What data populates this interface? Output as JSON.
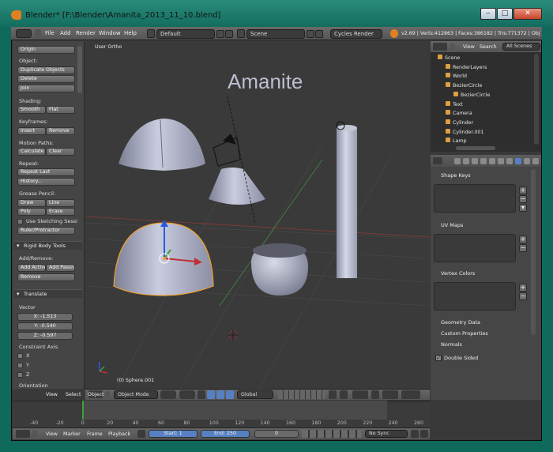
{
  "window": {
    "title": "Blender* [F:\\Blender\\Amanita_2013_11_10.blend]",
    "minimize": "‒",
    "maximize": "□",
    "close": "✕"
  },
  "info": {
    "menus": [
      "File",
      "Add",
      "Render",
      "Window",
      "Help"
    ],
    "layout": "Default",
    "scene": "Scene",
    "engine": "Cycles Render",
    "stats": "v2.69 | Verts:412863 | Faces:386182 | Tris:771372 | Obje"
  },
  "toolshelf": {
    "origin_btn": "Origin",
    "object_label": "Object:",
    "duplicate_btn": "Duplicate Objects",
    "delete_btn": "Delete",
    "join_btn": "Join",
    "shading_label": "Shading:",
    "smooth_btn": "Smooth",
    "flat_btn": "Flat",
    "keyframes_label": "Keyframes:",
    "insert_btn": "Insert",
    "remove_btn": "Remove",
    "motion_label": "Motion Paths:",
    "calculate_btn": "Calculate",
    "clear_btn": "Clear",
    "repeat_label": "Repeat:",
    "repeat_last_btn": "Repeat Last",
    "history_btn": "History...",
    "grease_label": "Grease Pencil:",
    "draw_btn": "Draw",
    "line_btn": "Line",
    "poly_btn": "Poly",
    "erase_btn": "Erase",
    "sketch_label": "Use Sketching Sessi",
    "ruler_btn": "Ruler/Protractor",
    "rigid_header": "Rigid Body Tools",
    "addremove_label": "Add/Remove:",
    "add_active_btn": "Add Active",
    "add_passive_btn": "Add Passiv",
    "rb_remove_btn": "Remove"
  },
  "translate": {
    "header": "Translate",
    "vector_label": "Vector",
    "x": "X: -1.513",
    "y": "Y: -0.540",
    "z": "Z: -0.597",
    "constraint_label": "Constraint Axis",
    "cx": "X",
    "cy": "Y",
    "cz": "Z",
    "orientation_label": "Orientation"
  },
  "viewport": {
    "view_label": "User Ortho",
    "object_label": "(0) Sphere.001",
    "text_object": "Amanite"
  },
  "view_header": {
    "view": "View",
    "select": "Select",
    "object": "Object",
    "mode": "Object Mode",
    "orientation": "Global"
  },
  "outliner": {
    "view": "View",
    "search": "Search",
    "scope": "All Scenes",
    "rows": [
      {
        "name": "Scene",
        "indent": 0
      },
      {
        "name": "RenderLayers",
        "indent": 1
      },
      {
        "name": "World",
        "indent": 1
      },
      {
        "name": "BezierCircle",
        "indent": 1
      },
      {
        "name": "BezierCircle",
        "indent": 2
      },
      {
        "name": "Text",
        "indent": 1
      },
      {
        "name": "Camera",
        "indent": 1
      },
      {
        "name": "Cylinder",
        "indent": 1
      },
      {
        "name": "Cylinder.001",
        "indent": 1
      },
      {
        "name": "Lamp",
        "indent": 1
      }
    ]
  },
  "properties": {
    "shape_keys": "Shape Keys",
    "uv_maps": "UV Maps",
    "vertex_colors": "Vertex Colors",
    "geometry_data": "Geometry Data",
    "custom_properties": "Custom Properties",
    "normals": "Normals",
    "double_sided": "Double Sided"
  },
  "timeline": {
    "ticks": [
      "-40",
      "-20",
      "0",
      "20",
      "40",
      "60",
      "80",
      "100",
      "120",
      "140",
      "160",
      "180",
      "200",
      "220",
      "240",
      "260"
    ],
    "view": "View",
    "marker": "Marker",
    "frame": "Frame",
    "playback": "Playback",
    "start": "Start: 1",
    "end": "End: 250",
    "current": "0",
    "sync": "No Sync"
  },
  "colors": {
    "accent": "#5680c2",
    "selection": "#f0a030",
    "axis_x": "#c0303a",
    "axis_y": "#3aa03a",
    "axis_z": "#2a5ae0"
  }
}
